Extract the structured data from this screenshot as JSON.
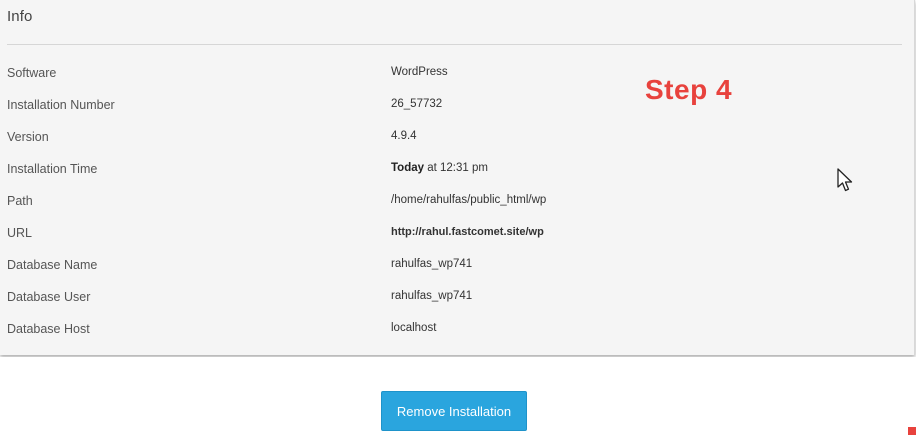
{
  "panel": {
    "title": "Info"
  },
  "details": [
    {
      "label": "Software",
      "value": "WordPress"
    },
    {
      "label": "Installation Number",
      "value": "26_57732"
    },
    {
      "label": "Version",
      "value": "4.9.4"
    },
    {
      "label": "Installation Time",
      "value_bold": "Today",
      "value": " at 12:31 pm"
    },
    {
      "label": "Path",
      "value": "/home/rahulfas/public_html/wp"
    },
    {
      "label": "URL",
      "value": "http://rahul.fastcomet.site/wp"
    },
    {
      "label": "Database Name",
      "value": "rahulfas_wp741"
    },
    {
      "label": "Database User",
      "value": "rahulfas_wp741"
    },
    {
      "label": "Database Host",
      "value": "localhost"
    }
  ],
  "annotation": {
    "step_text": "Step 4",
    "color": "#e8423d"
  },
  "actions": {
    "remove_label": "Remove Installation",
    "button_color": "#2aa5de"
  },
  "icons": {
    "cursor": "mouse-pointer-icon"
  }
}
